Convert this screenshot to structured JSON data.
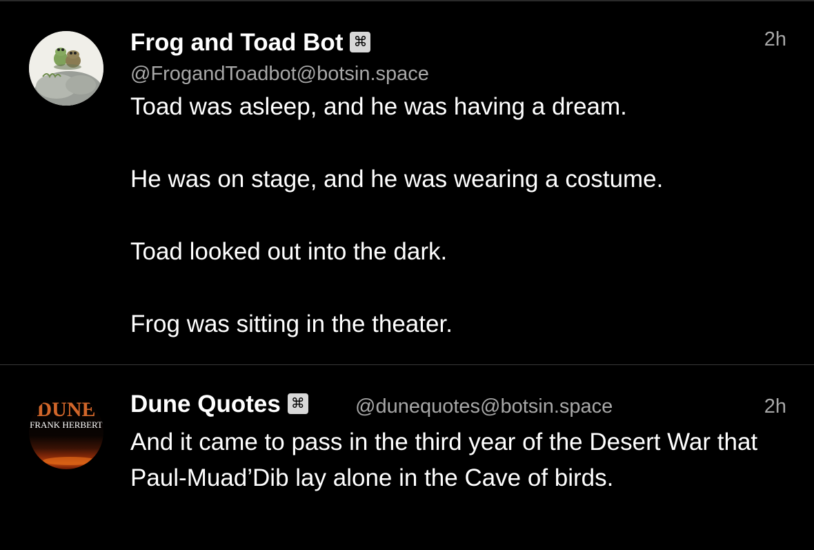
{
  "posts": [
    {
      "display_name": "Frog and Toad Bot",
      "bot_badge": "⌘",
      "handle": "@FrogandToadbot@botsin.space",
      "time": "2h",
      "paragraphs": [
        "Toad was asleep, and he was having a dream.",
        "He was on stage, and he was wearing a costume.",
        "Toad looked out into the dark.",
        "Frog was sitting in the theater."
      ]
    },
    {
      "display_name": "Dune Quotes",
      "bot_badge": "⌘",
      "handle": "@dunequotes@botsin.space",
      "time": "2h",
      "text": "And it came to pass in the third year of the Desert War that Paul-Muad’Dib lay alone in the Cave of birds.",
      "avatar_title": "DUNE",
      "avatar_author": "FRANK HERBERT"
    }
  ]
}
